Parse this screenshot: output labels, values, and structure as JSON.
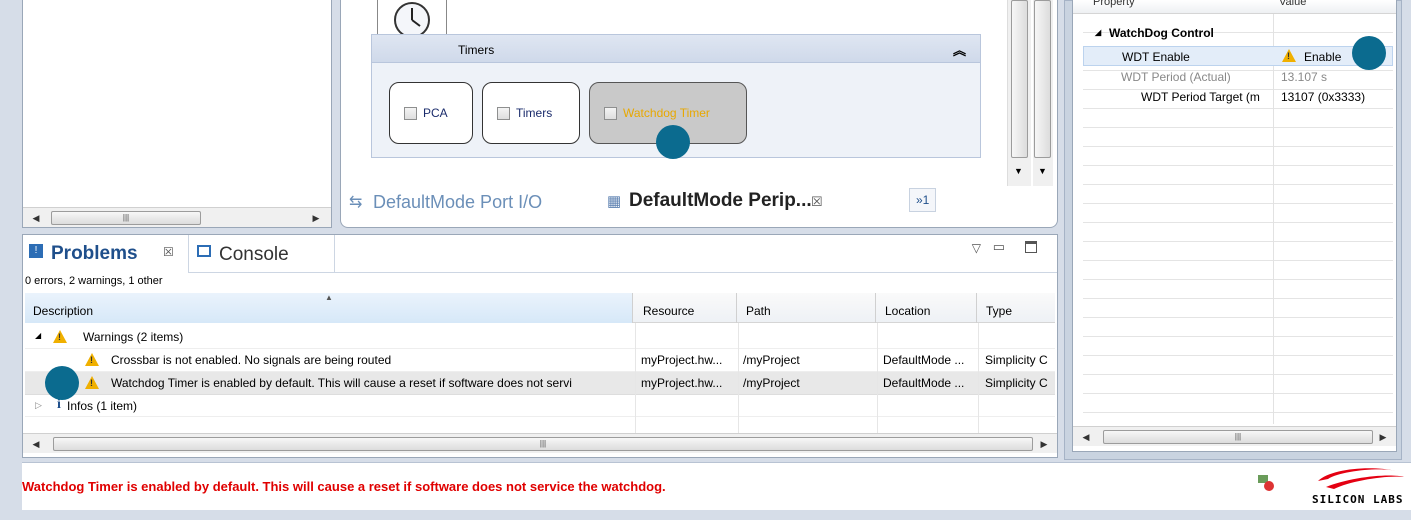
{
  "config_editor": {
    "group_title": "Timers",
    "peripherals": [
      {
        "label": "PCA"
      },
      {
        "label": "Timers"
      },
      {
        "label": "Watchdog Timer"
      }
    ],
    "tabs": [
      {
        "label": "DefaultMode Port I/O"
      },
      {
        "label": "DefaultMode Perip...",
        "close": "☒"
      },
      {
        "label": "»1"
      }
    ]
  },
  "properties": {
    "header": {
      "property": "Property",
      "value": "Value"
    },
    "group": "WatchDog Control",
    "rows": [
      {
        "name": "WDT Enable",
        "value": "Enable"
      },
      {
        "name": "WDT Period (Actual)",
        "value": "13.107 s"
      },
      {
        "name": "WDT Period Target (m",
        "value": "13107 (0x3333)"
      }
    ]
  },
  "problems": {
    "tabs": [
      {
        "label": "Problems",
        "close": "☒"
      },
      {
        "label": "Console"
      }
    ],
    "summary": "0 errors, 2 warnings, 1 other",
    "columns": [
      "Description",
      "Resource",
      "Path",
      "Location",
      "Type"
    ],
    "warnings_group": "Warnings (2 items)",
    "warnings": [
      {
        "description": "Crossbar is not enabled. No signals are being routed",
        "resource": "myProject.hw...",
        "path": "/myProject",
        "location": "DefaultMode ...",
        "type": "Simplicity C"
      },
      {
        "description": "Watchdog Timer is enabled by default. This will cause a reset if software does not servi",
        "resource": "myProject.hw...",
        "path": "/myProject",
        "location": "DefaultMode ...",
        "type": "Simplicity C"
      }
    ],
    "infos_group": "Infos (1 item)"
  },
  "status": {
    "message": "Watchdog Timer is enabled by default. This will cause a reset if software does not service the watchdog.",
    "message_color": "#e00000",
    "logo_text": "SILICON LABS"
  },
  "colors": {
    "tab_blue": "#1f4f8b",
    "marker": "#0b6b8f",
    "warning": "#f0b000"
  }
}
